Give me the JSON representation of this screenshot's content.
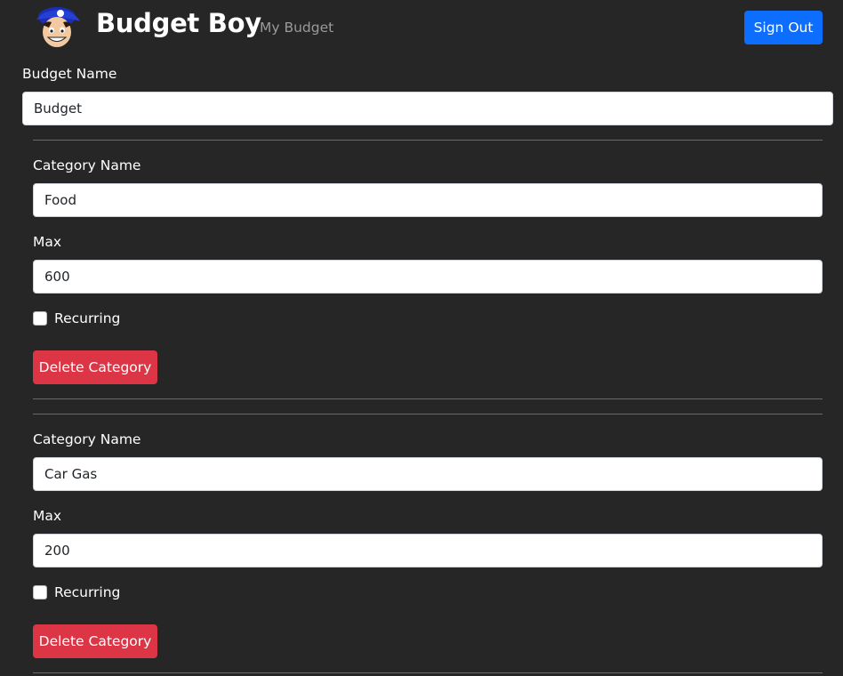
{
  "header": {
    "brand": "Budget Boy",
    "nav_link": "My Budget",
    "sign_out_label": "Sign Out"
  },
  "budget": {
    "name_label": "Budget Name",
    "name_value": "Budget"
  },
  "categories": [
    {
      "name_label": "Category Name",
      "name_value": "Food",
      "max_label": "Max",
      "max_value": "600",
      "recurring_label": "Recurring",
      "recurring_checked": false,
      "delete_label": "Delete Category"
    },
    {
      "name_label": "Category Name",
      "name_value": "Car Gas",
      "max_label": "Max",
      "max_value": "200",
      "recurring_label": "Recurring",
      "recurring_checked": false,
      "delete_label": "Delete Category"
    }
  ],
  "colors": {
    "background": "#262626",
    "primary": "#0d6efd",
    "danger": "#dc3545",
    "nav_muted": "#9a9a9a"
  }
}
